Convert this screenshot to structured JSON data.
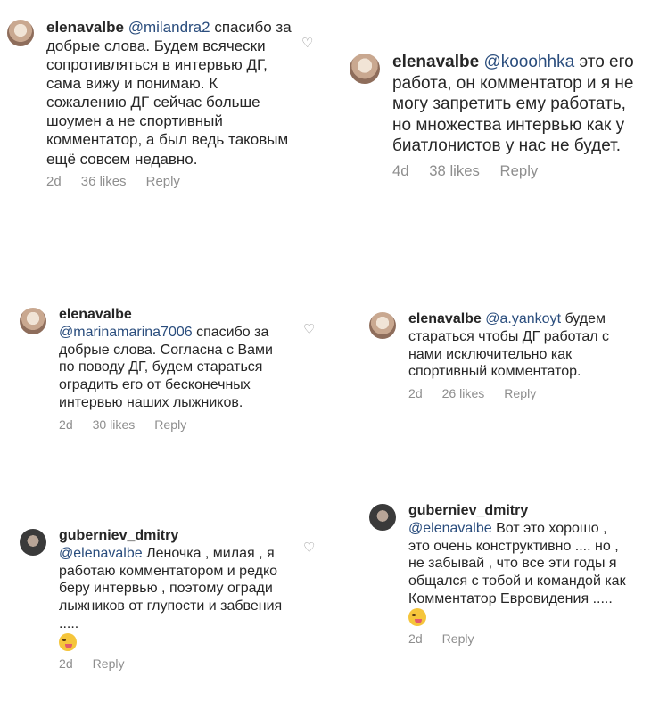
{
  "comments": [
    {
      "user": "elenavalbe",
      "mention": "@milandra2",
      "text": "спасибо за добрые слова. Будем всячески сопротивляться в интервью ДГ, сама вижу и понимаю. К сожалению ДГ сейчас больше шоумен а не спортивный комментатор, а был ведь таковым ещё совсем недавно.",
      "time": "2d",
      "likes": "36 likes",
      "reply": "Reply"
    },
    {
      "user": "elenavalbe",
      "mention": "@kooohhka",
      "text": "это его работа, он комментатор и я не могу запретить ему работать, но множества интервью как у биатлонистов у нас не будет.",
      "time": "4d",
      "likes": "38 likes",
      "reply": "Reply"
    },
    {
      "user": "elenavalbe",
      "mention": "@marinamarina7006",
      "text": "спасибо за добрые слова. Согласна с Вами по поводу ДГ, будем стараться оградить его от бесконечных интервью наших лыжников.",
      "time": "2d",
      "likes": "30 likes",
      "reply": "Reply"
    },
    {
      "user": "elenavalbe",
      "mention": "@a.yankoyt",
      "text": "будем стараться чтобы ДГ работал с нами исключительно как спортивный комментатор.",
      "time": "2d",
      "likes": "26 likes",
      "reply": "Reply"
    },
    {
      "user": "guberniev_dmitry",
      "mention": "@elenavalbe",
      "text": "Леночка , милая , я работаю комментатором и редко беру интервью , поэтому огради лыжников от глупости и забвения .....",
      "time": "2d",
      "likes": "",
      "reply": "Reply"
    },
    {
      "user": "guberniev_dmitry",
      "mention": "@elenavalbe",
      "text": "Вот это хорошо , это очень конструктивно .... но , не забывай , что все эти годы я общался с тобой и командой как Комментатор Евровидения .....",
      "time": "2d",
      "likes": "",
      "reply": "Reply"
    }
  ],
  "icons": {
    "heart": "heart-icon",
    "emoji": "grinning-tongue-emoji"
  }
}
